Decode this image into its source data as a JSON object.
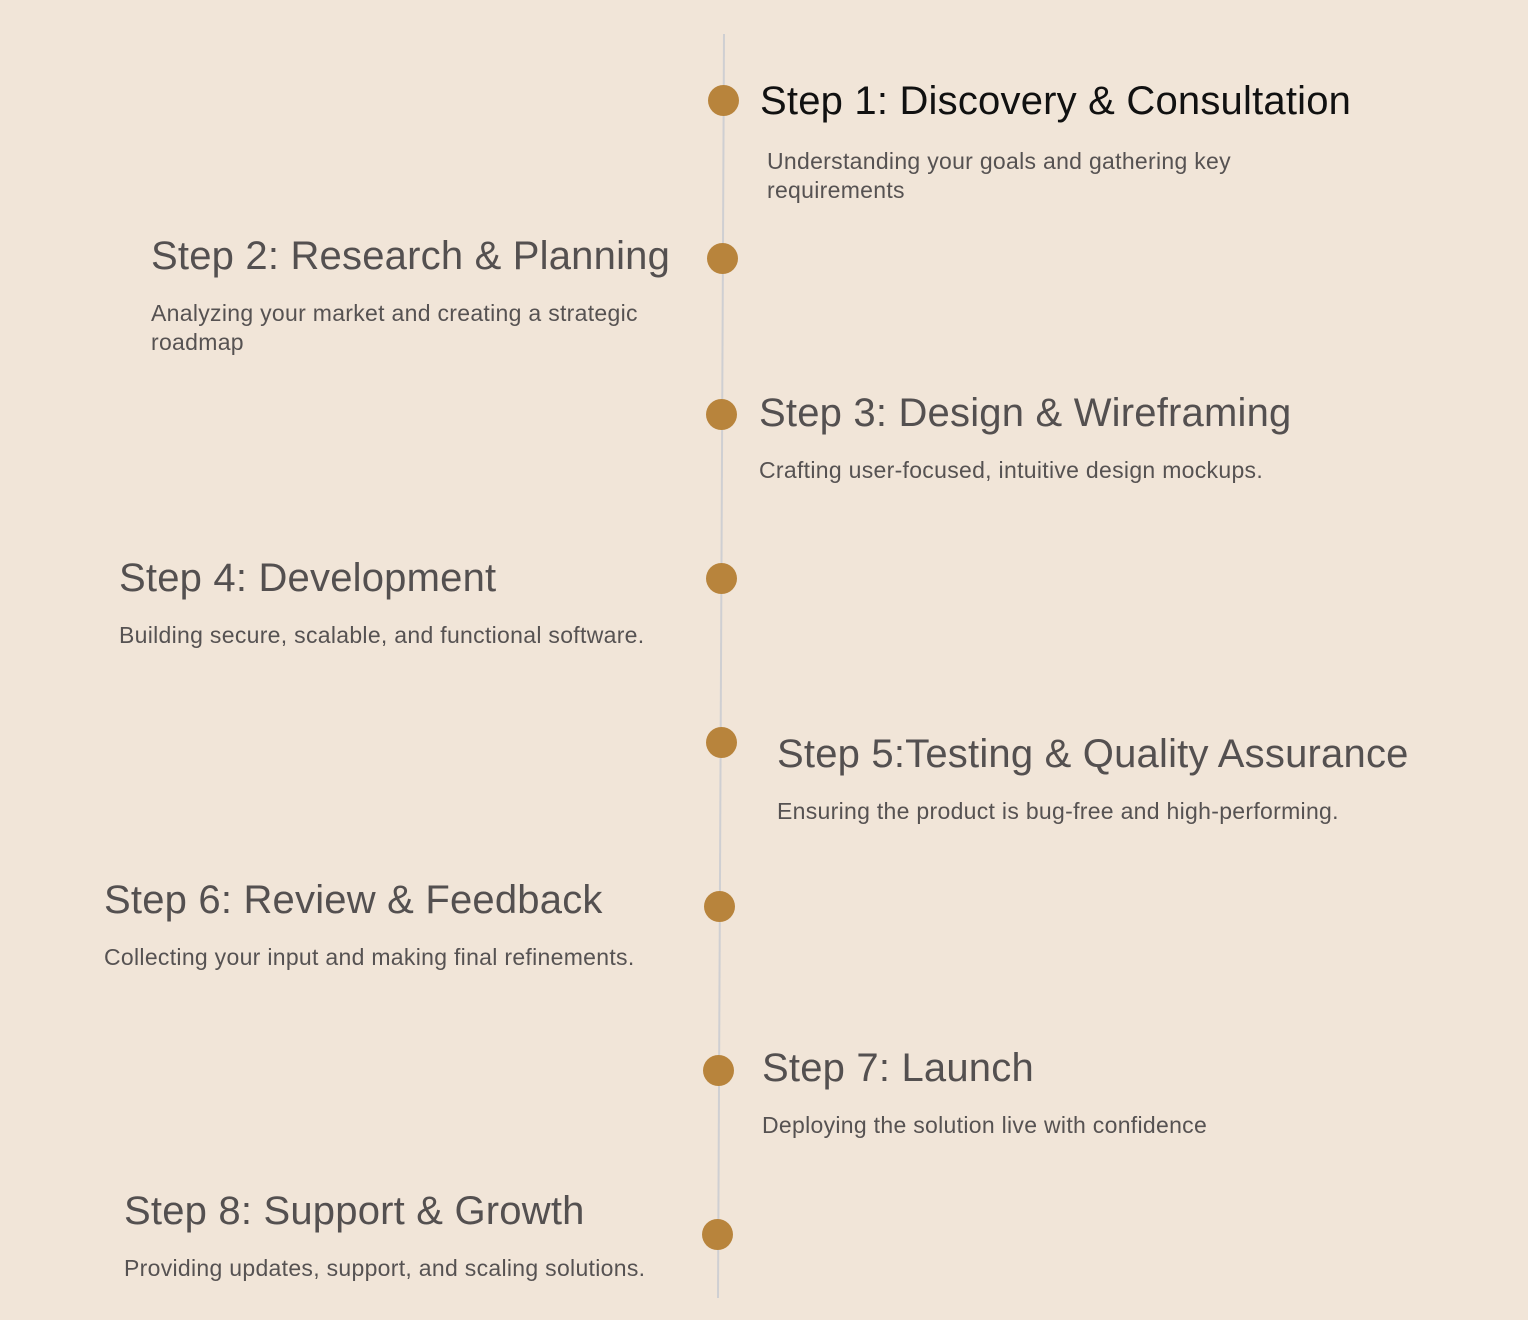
{
  "colors": {
    "background": "#f1e5d8",
    "dot": "#b8843c",
    "line": "#cfcfd2",
    "title": "#545050",
    "title_first": "#111111",
    "description": "#565252"
  },
  "steps": [
    {
      "title": "Step 1: Discovery & Consultation",
      "description": "Understanding your goals and gathering key requirements"
    },
    {
      "title": "Step 2: Research & Planning",
      "description": "Analyzing your market and creating a strategic roadmap"
    },
    {
      "title": "Step 3: Design & Wireframing",
      "description": "Crafting user-focused, intuitive design mockups."
    },
    {
      "title": "Step 4: Development",
      "description": "Building secure, scalable, and functional software."
    },
    {
      "title": "Step 5:Testing & Quality Assurance",
      "description": "Ensuring the product is bug-free and high-performing."
    },
    {
      "title": "Step 6: Review & Feedback",
      "description": "Collecting your input and making final refinements."
    },
    {
      "title": "Step 7: Launch",
      "description": "Deploying the solution live with confidence"
    },
    {
      "title": "Step 8: Support & Growth",
      "description": "Providing updates, support, and scaling solutions."
    }
  ]
}
